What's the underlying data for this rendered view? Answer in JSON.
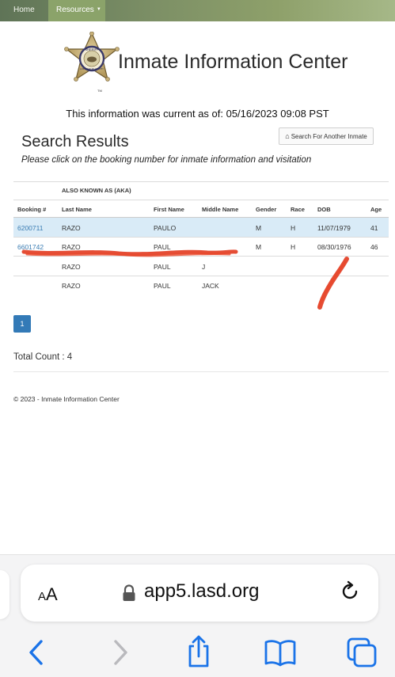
{
  "nav": {
    "home": "Home",
    "resources": "Resources"
  },
  "header": {
    "title": "Inmate Information Center",
    "badge_lines": [
      "SHERIFF",
      "LOS ANGELES COUNTY",
      "TM"
    ]
  },
  "info": {
    "current_line": "This information was current as of: 05/16/2023 09:08 PST"
  },
  "search_button": {
    "label": "Search For Another Inmate",
    "icon": "home-icon"
  },
  "results": {
    "title": "Search Results",
    "subtitle": "Please click on the booking number for inmate information and visitation"
  },
  "table": {
    "group_header": "ALSO KNOWN AS (AKA)",
    "columns": [
      "Booking #",
      "Last Name",
      "First Name",
      "Middle Name",
      "Gender",
      "Race",
      "DOB",
      "Age"
    ],
    "rows": [
      {
        "booking": "6200711",
        "last": "RAZO",
        "first": "PAULO",
        "middle": "",
        "gender": "M",
        "race": "H",
        "dob": "11/07/1979",
        "age": "41"
      },
      {
        "booking": "6601742",
        "last": "RAZO",
        "first": "PAUL",
        "middle": "",
        "gender": "M",
        "race": "H",
        "dob": "08/30/1976",
        "age": "46"
      },
      {
        "booking": "",
        "last": "RAZO",
        "first": "PAUL",
        "middle": "J",
        "gender": "",
        "race": "",
        "dob": "",
        "age": ""
      },
      {
        "booking": "",
        "last": "RAZO",
        "first": "PAUL",
        "middle": "JACK",
        "gender": "",
        "race": "",
        "dob": "",
        "age": ""
      }
    ]
  },
  "pagination": {
    "current_page": "1"
  },
  "total": {
    "label": "Total Count : 4"
  },
  "footer": {
    "text": "© 2023 - Inmate Information Center"
  },
  "browser": {
    "text_size_label_big": "A",
    "text_size_label_small": "A",
    "url": "app5.lasd.org",
    "icons": [
      "lock-icon",
      "reload-icon",
      "back-icon",
      "forward-icon",
      "share-icon",
      "bookmarks-icon",
      "tabs-icon"
    ]
  },
  "colors": {
    "nav_gradient_start": "#5f7457",
    "nav_gradient_end": "#a6b888",
    "link": "#3b7db3",
    "highlight_row": "#d9ebf7",
    "page_button": "#337ab7",
    "scribble": "#e23a1f",
    "ios_blue": "#1a73e8"
  }
}
